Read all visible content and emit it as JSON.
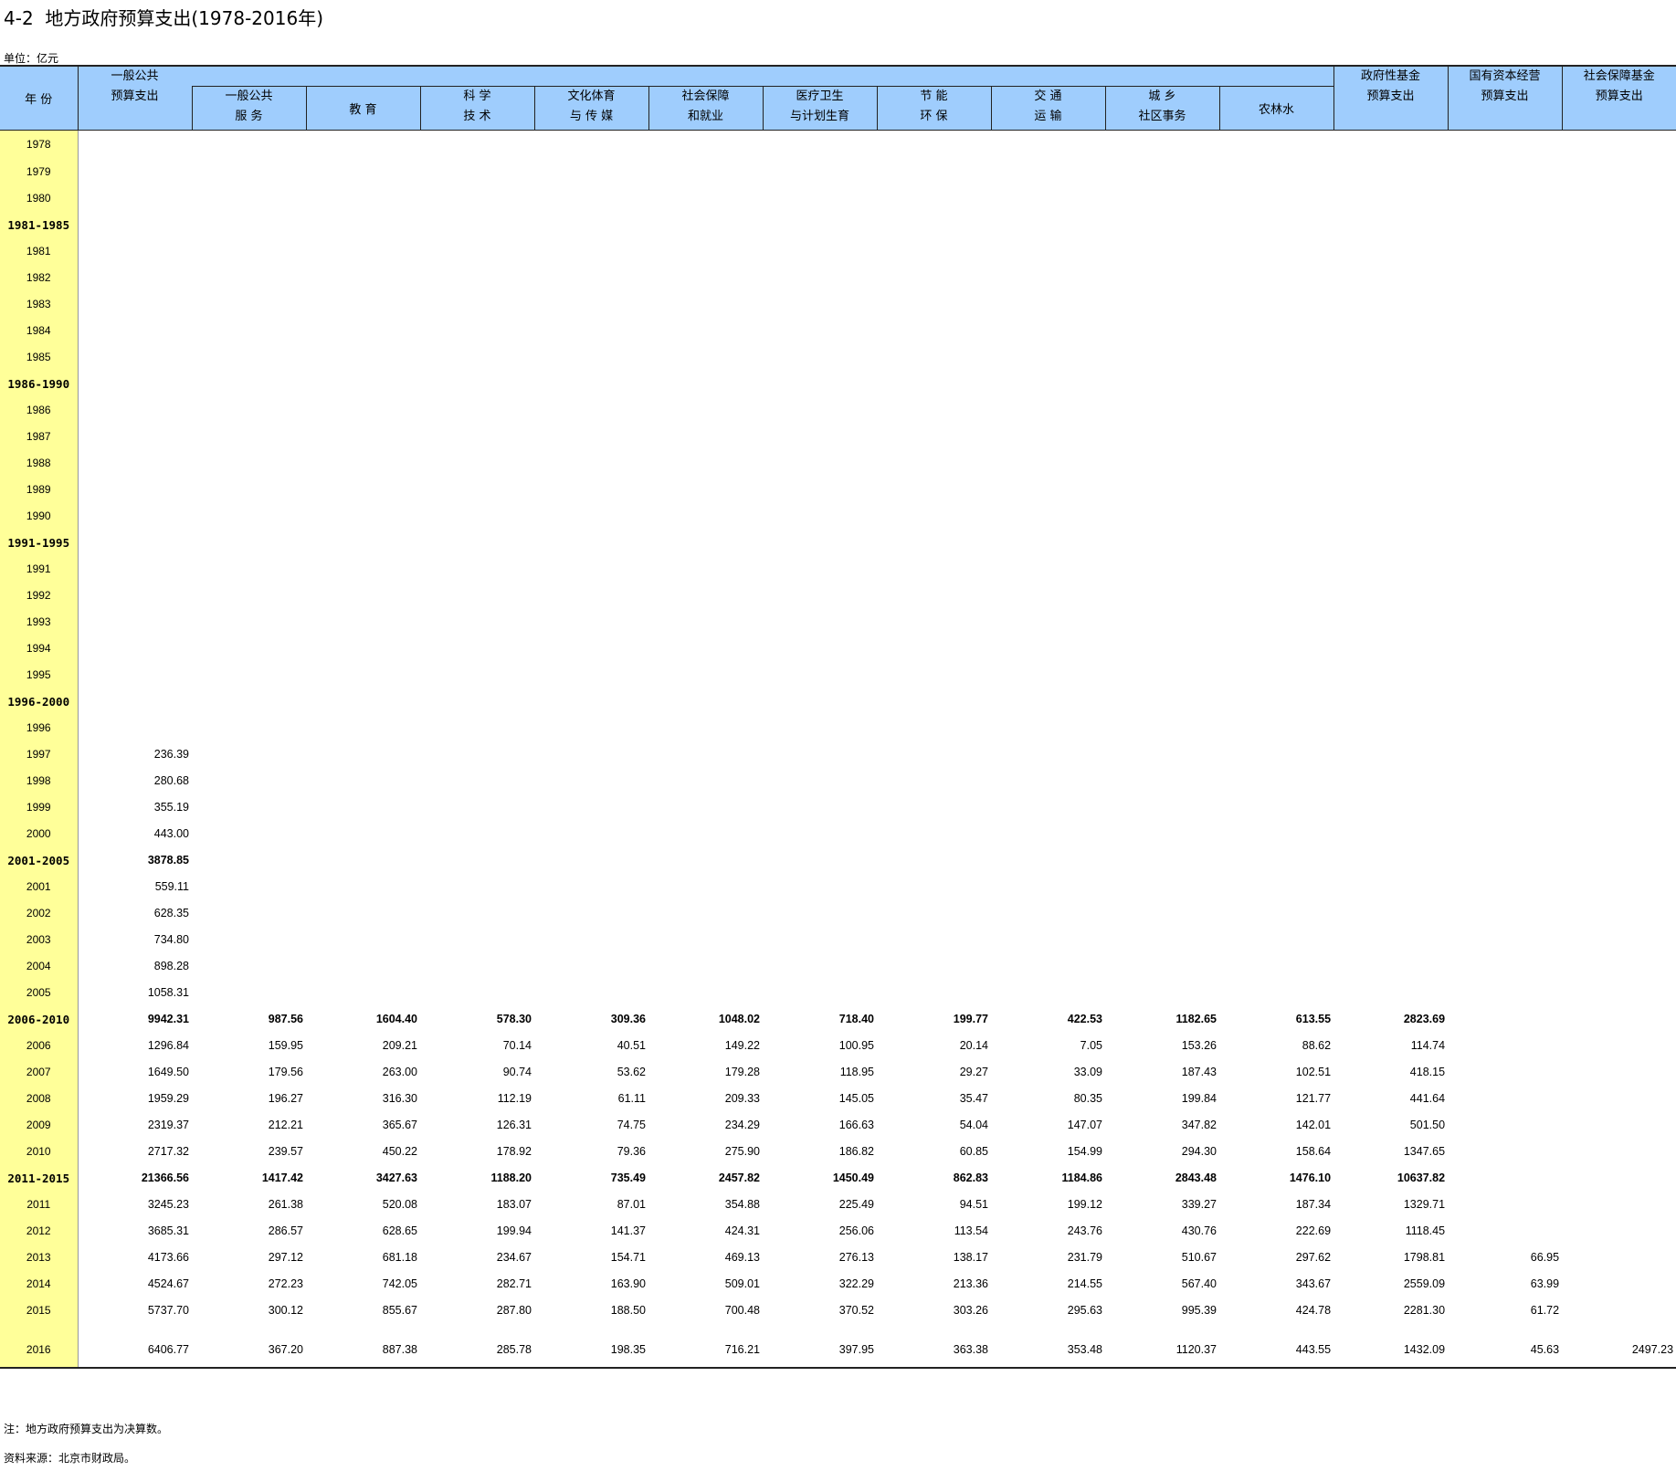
{
  "title": "4-2  地方政府预算支出(1978-2016年)",
  "unit": "单位：亿元",
  "columns": {
    "year": "年 份",
    "general_total_l1": "一般公共",
    "general_total_l2": "预算支出",
    "c1_l1": "一般公共",
    "c1_l2": "服 务",
    "c2_l1": "教 育",
    "c3_l1": "科 学",
    "c3_l2": "技 术",
    "c4_l1": "文化体育",
    "c4_l2": "与 传 媒",
    "c5_l1": "社会保障",
    "c5_l2": "和就业",
    "c6_l1": "医疗卫生",
    "c6_l2": "与计划生育",
    "c7_l1": "节 能",
    "c7_l2": "环 保",
    "c8_l1": "交 通",
    "c8_l2": "运 输",
    "c9_l1": "城 乡",
    "c9_l2": "社区事务",
    "c10_l1": "农林水",
    "fund_l1": "政府性基金",
    "fund_l2": "预算支出",
    "soe_l1": "国有资本经营",
    "soe_l2": "预算支出",
    "ss_l1": "社会保障基金",
    "ss_l2": "预算支出"
  },
  "rows": [
    {
      "year": "1978",
      "bold": false,
      "cells": [
        "",
        "",
        "",
        "",
        "",
        "",
        "",
        "",
        "",
        "",
        "",
        "",
        "",
        "",
        ""
      ]
    },
    {
      "year": "1979",
      "bold": false,
      "cells": [
        "",
        "",
        "",
        "",
        "",
        "",
        "",
        "",
        "",
        "",
        "",
        "",
        "",
        "",
        ""
      ]
    },
    {
      "year": "1980",
      "bold": false,
      "cells": [
        "",
        "",
        "",
        "",
        "",
        "",
        "",
        "",
        "",
        "",
        "",
        "",
        "",
        "",
        ""
      ]
    },
    {
      "year": "1981-1985",
      "bold": true,
      "cells": [
        "",
        "",
        "",
        "",
        "",
        "",
        "",
        "",
        "",
        "",
        "",
        "",
        "",
        "",
        ""
      ]
    },
    {
      "year": "1981",
      "bold": false,
      "cells": [
        "",
        "",
        "",
        "",
        "",
        "",
        "",
        "",
        "",
        "",
        "",
        "",
        "",
        "",
        ""
      ]
    },
    {
      "year": "1982",
      "bold": false,
      "cells": [
        "",
        "",
        "",
        "",
        "",
        "",
        "",
        "",
        "",
        "",
        "",
        "",
        "",
        "",
        ""
      ]
    },
    {
      "year": "1983",
      "bold": false,
      "cells": [
        "",
        "",
        "",
        "",
        "",
        "",
        "",
        "",
        "",
        "",
        "",
        "",
        "",
        "",
        ""
      ]
    },
    {
      "year": "1984",
      "bold": false,
      "cells": [
        "",
        "",
        "",
        "",
        "",
        "",
        "",
        "",
        "",
        "",
        "",
        "",
        "",
        "",
        ""
      ]
    },
    {
      "year": "1985",
      "bold": false,
      "cells": [
        "",
        "",
        "",
        "",
        "",
        "",
        "",
        "",
        "",
        "",
        "",
        "",
        "",
        "",
        ""
      ]
    },
    {
      "year": "1986-1990",
      "bold": true,
      "cells": [
        "",
        "",
        "",
        "",
        "",
        "",
        "",
        "",
        "",
        "",
        "",
        "",
        "",
        "",
        ""
      ]
    },
    {
      "year": "1986",
      "bold": false,
      "cells": [
        "",
        "",
        "",
        "",
        "",
        "",
        "",
        "",
        "",
        "",
        "",
        "",
        "",
        "",
        ""
      ]
    },
    {
      "year": "1987",
      "bold": false,
      "cells": [
        "",
        "",
        "",
        "",
        "",
        "",
        "",
        "",
        "",
        "",
        "",
        "",
        "",
        "",
        ""
      ]
    },
    {
      "year": "1988",
      "bold": false,
      "cells": [
        "",
        "",
        "",
        "",
        "",
        "",
        "",
        "",
        "",
        "",
        "",
        "",
        "",
        "",
        ""
      ]
    },
    {
      "year": "1989",
      "bold": false,
      "cells": [
        "",
        "",
        "",
        "",
        "",
        "",
        "",
        "",
        "",
        "",
        "",
        "",
        "",
        "",
        ""
      ]
    },
    {
      "year": "1990",
      "bold": false,
      "cells": [
        "",
        "",
        "",
        "",
        "",
        "",
        "",
        "",
        "",
        "",
        "",
        "",
        "",
        "",
        ""
      ]
    },
    {
      "year": "1991-1995",
      "bold": true,
      "cells": [
        "",
        "",
        "",
        "",
        "",
        "",
        "",
        "",
        "",
        "",
        "",
        "",
        "",
        "",
        ""
      ]
    },
    {
      "year": "1991",
      "bold": false,
      "cells": [
        "",
        "",
        "",
        "",
        "",
        "",
        "",
        "",
        "",
        "",
        "",
        "",
        "",
        "",
        ""
      ]
    },
    {
      "year": "1992",
      "bold": false,
      "cells": [
        "",
        "",
        "",
        "",
        "",
        "",
        "",
        "",
        "",
        "",
        "",
        "",
        "",
        "",
        ""
      ]
    },
    {
      "year": "1993",
      "bold": false,
      "cells": [
        "",
        "",
        "",
        "",
        "",
        "",
        "",
        "",
        "",
        "",
        "",
        "",
        "",
        "",
        ""
      ]
    },
    {
      "year": "1994",
      "bold": false,
      "cells": [
        "",
        "",
        "",
        "",
        "",
        "",
        "",
        "",
        "",
        "",
        "",
        "",
        "",
        "",
        ""
      ]
    },
    {
      "year": "1995",
      "bold": false,
      "cells": [
        "",
        "",
        "",
        "",
        "",
        "",
        "",
        "",
        "",
        "",
        "",
        "",
        "",
        "",
        ""
      ]
    },
    {
      "year": "1996-2000",
      "bold": true,
      "cells": [
        "",
        "",
        "",
        "",
        "",
        "",
        "",
        "",
        "",
        "",
        "",
        "",
        "",
        "",
        ""
      ]
    },
    {
      "year": "1996",
      "bold": false,
      "cells": [
        "",
        "",
        "",
        "",
        "",
        "",
        "",
        "",
        "",
        "",
        "",
        "",
        "",
        "",
        ""
      ]
    },
    {
      "year": "1997",
      "bold": false,
      "cells": [
        "236.39",
        "",
        "",
        "",
        "",
        "",
        "",
        "",
        "",
        "",
        "",
        "",
        "",
        "",
        ""
      ]
    },
    {
      "year": "1998",
      "bold": false,
      "cells": [
        "280.68",
        "",
        "",
        "",
        "",
        "",
        "",
        "",
        "",
        "",
        "",
        "",
        "",
        "",
        ""
      ]
    },
    {
      "year": "1999",
      "bold": false,
      "cells": [
        "355.19",
        "",
        "",
        "",
        "",
        "",
        "",
        "",
        "",
        "",
        "",
        "",
        "",
        "",
        ""
      ]
    },
    {
      "year": "2000",
      "bold": false,
      "cells": [
        "443.00",
        "",
        "",
        "",
        "",
        "",
        "",
        "",
        "",
        "",
        "",
        "",
        "",
        "",
        ""
      ]
    },
    {
      "year": "2001-2005",
      "bold": true,
      "cells": [
        "3878.85",
        "",
        "",
        "",
        "",
        "",
        "",
        "",
        "",
        "",
        "",
        "",
        "",
        "",
        ""
      ]
    },
    {
      "year": "2001",
      "bold": false,
      "cells": [
        "559.11",
        "",
        "",
        "",
        "",
        "",
        "",
        "",
        "",
        "",
        "",
        "",
        "",
        "",
        ""
      ]
    },
    {
      "year": "2002",
      "bold": false,
      "cells": [
        "628.35",
        "",
        "",
        "",
        "",
        "",
        "",
        "",
        "",
        "",
        "",
        "",
        "",
        "",
        ""
      ]
    },
    {
      "year": "2003",
      "bold": false,
      "cells": [
        "734.80",
        "",
        "",
        "",
        "",
        "",
        "",
        "",
        "",
        "",
        "",
        "",
        "",
        "",
        ""
      ]
    },
    {
      "year": "2004",
      "bold": false,
      "cells": [
        "898.28",
        "",
        "",
        "",
        "",
        "",
        "",
        "",
        "",
        "",
        "",
        "",
        "",
        "",
        ""
      ]
    },
    {
      "year": "2005",
      "bold": false,
      "cells": [
        "1058.31",
        "",
        "",
        "",
        "",
        "",
        "",
        "",
        "",
        "",
        "",
        "",
        "",
        "",
        ""
      ]
    },
    {
      "year": "2006-2010",
      "bold": true,
      "cells": [
        "9942.31",
        "987.56",
        "1604.40",
        "578.30",
        "309.36",
        "1048.02",
        "718.40",
        "199.77",
        "422.53",
        "1182.65",
        "613.55",
        "2823.69",
        "",
        "",
        ""
      ]
    },
    {
      "year": "2006",
      "bold": false,
      "cells": [
        "1296.84",
        "159.95",
        "209.21",
        "70.14",
        "40.51",
        "149.22",
        "100.95",
        "20.14",
        "7.05",
        "153.26",
        "88.62",
        "114.74",
        "",
        "",
        ""
      ]
    },
    {
      "year": "2007",
      "bold": false,
      "cells": [
        "1649.50",
        "179.56",
        "263.00",
        "90.74",
        "53.62",
        "179.28",
        "118.95",
        "29.27",
        "33.09",
        "187.43",
        "102.51",
        "418.15",
        "",
        "",
        ""
      ]
    },
    {
      "year": "2008",
      "bold": false,
      "cells": [
        "1959.29",
        "196.27",
        "316.30",
        "112.19",
        "61.11",
        "209.33",
        "145.05",
        "35.47",
        "80.35",
        "199.84",
        "121.77",
        "441.64",
        "",
        "",
        ""
      ]
    },
    {
      "year": "2009",
      "bold": false,
      "cells": [
        "2319.37",
        "212.21",
        "365.67",
        "126.31",
        "74.75",
        "234.29",
        "166.63",
        "54.04",
        "147.07",
        "347.82",
        "142.01",
        "501.50",
        "",
        "",
        ""
      ]
    },
    {
      "year": "2010",
      "bold": false,
      "cells": [
        "2717.32",
        "239.57",
        "450.22",
        "178.92",
        "79.36",
        "275.90",
        "186.82",
        "60.85",
        "154.99",
        "294.30",
        "158.64",
        "1347.65",
        "",
        "",
        ""
      ]
    },
    {
      "year": "2011-2015",
      "bold": true,
      "cells": [
        "21366.56",
        "1417.42",
        "3427.63",
        "1188.20",
        "735.49",
        "2457.82",
        "1450.49",
        "862.83",
        "1184.86",
        "2843.48",
        "1476.10",
        "10637.82",
        "",
        "",
        ""
      ]
    },
    {
      "year": "2011",
      "bold": false,
      "cells": [
        "3245.23",
        "261.38",
        "520.08",
        "183.07",
        "87.01",
        "354.88",
        "225.49",
        "94.51",
        "199.12",
        "339.27",
        "187.34",
        "1329.71",
        "",
        "",
        ""
      ]
    },
    {
      "year": "2012",
      "bold": false,
      "cells": [
        "3685.31",
        "286.57",
        "628.65",
        "199.94",
        "141.37",
        "424.31",
        "256.06",
        "113.54",
        "243.76",
        "430.76",
        "222.69",
        "1118.45",
        "",
        "",
        ""
      ]
    },
    {
      "year": "2013",
      "bold": false,
      "cells": [
        "4173.66",
        "297.12",
        "681.18",
        "234.67",
        "154.71",
        "469.13",
        "276.13",
        "138.17",
        "231.79",
        "510.67",
        "297.62",
        "1798.81",
        "66.95",
        "",
        ""
      ]
    },
    {
      "year": "2014",
      "bold": false,
      "cells": [
        "4524.67",
        "272.23",
        "742.05",
        "282.71",
        "163.90",
        "509.01",
        "322.29",
        "213.36",
        "214.55",
        "567.40",
        "343.67",
        "2559.09",
        "63.99",
        "",
        ""
      ]
    },
    {
      "year": "2015",
      "bold": false,
      "cells": [
        "5737.70",
        "300.12",
        "855.67",
        "287.80",
        "188.50",
        "700.48",
        "370.52",
        "303.26",
        "295.63",
        "995.39",
        "424.78",
        "2281.30",
        "61.72",
        "",
        ""
      ]
    },
    {
      "year": "",
      "bold": false,
      "spacer": true,
      "cells": [
        "",
        "",
        "",
        "",
        "",
        "",
        "",
        "",
        "",
        "",
        "",
        "",
        "",
        "",
        ""
      ]
    },
    {
      "year": "2016",
      "bold": false,
      "cells": [
        "6406.77",
        "367.20",
        "887.38",
        "285.78",
        "198.35",
        "716.21",
        "397.95",
        "363.38",
        "353.48",
        "1120.37",
        "443.55",
        "1432.09",
        "45.63",
        "2497.23",
        ""
      ]
    }
  ],
  "notes": {
    "note1": "注：地方政府预算支出为决算数。",
    "note2": "资料来源：北京市财政局。"
  },
  "colors": {
    "header": "#9fcdfd",
    "year_column": "#ffff99"
  }
}
